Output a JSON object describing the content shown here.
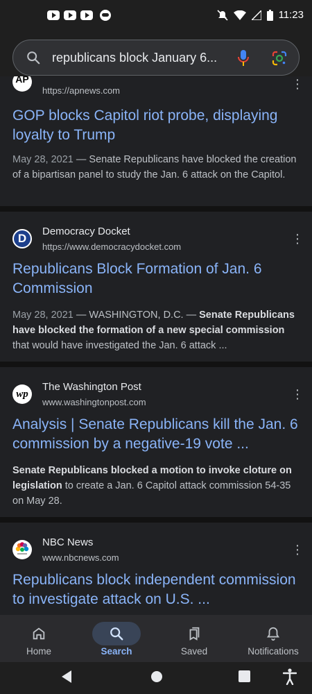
{
  "status_bar": {
    "time": "11:23"
  },
  "search": {
    "query": "republicans block January 6..."
  },
  "results": [
    {
      "site": "",
      "url": "https://apnews.com",
      "favicon": "AP",
      "title": "GOP blocks Capitol riot probe, displaying loyalty to Trump",
      "date": "May 28, 2021",
      "snippet": " — Senate Republicans have blocked the creation of a bipartisan panel to study the Jan. 6 attack on the Capitol."
    },
    {
      "site": "Democracy Docket",
      "url": "https://www.democracydocket.com",
      "favicon": "D",
      "title": "Republicans Block Formation of Jan. 6 Commission",
      "date": "May 28, 2021",
      "snippet_plain": " — WASHINGTON, D.C. — ",
      "snippet_bold": "Senate Republicans have blocked the formation of a new special commission",
      "snippet_tail": " that would have investigated the Jan. 6 attack ..."
    },
    {
      "site": "The Washington Post",
      "url": "www.washingtonpost.com",
      "favicon": "wp",
      "title": "Analysis | Senate Republicans kill the Jan. 6 commission by a negative-19 vote ...",
      "snippet_bold": "Senate Republicans blocked a motion to invoke cloture on legislation",
      "snippet_tail": " to create a Jan. 6 Capitol attack commission 54-35 on May 28."
    },
    {
      "site": "NBC News",
      "url": "www.nbcnews.com",
      "favicon": "nbc-peacock",
      "title": "Republicans block independent commission to investigate attack on U.S. ..."
    }
  ],
  "bottom_nav": [
    {
      "label": "Home",
      "icon": "home-icon"
    },
    {
      "label": "Search",
      "icon": "search-icon",
      "active": true
    },
    {
      "label": "Saved",
      "icon": "saved-icon"
    },
    {
      "label": "Notifications",
      "icon": "bell-icon"
    }
  ],
  "colors": {
    "link": "#8ab4f8",
    "background": "#202124",
    "active_nav": "#394457"
  }
}
